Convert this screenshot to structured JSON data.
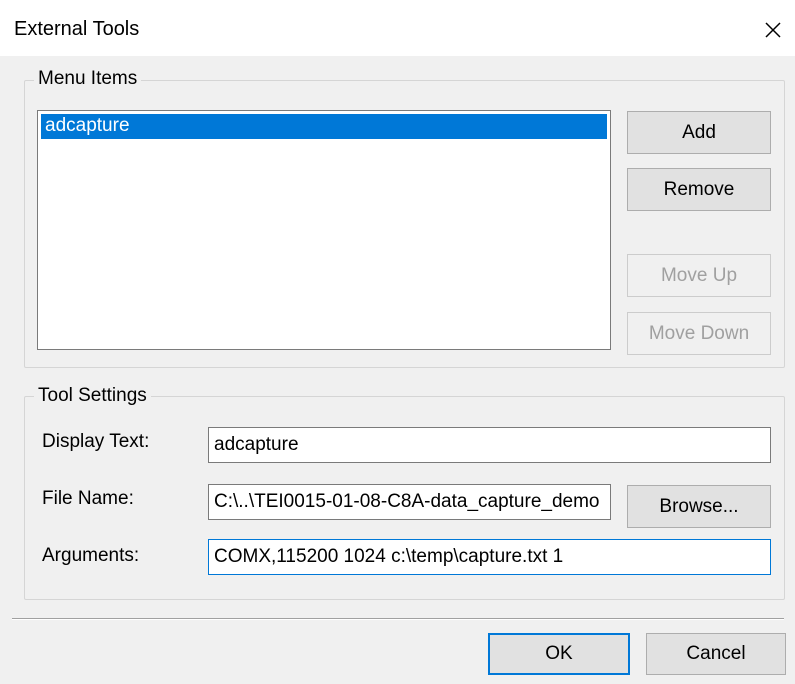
{
  "window": {
    "title": "External Tools"
  },
  "menu_items": {
    "group_label": "Menu Items",
    "items": [
      "adcapture"
    ],
    "selected_index": 0,
    "buttons": {
      "add": "Add",
      "remove": "Remove",
      "move_up": "Move Up",
      "move_down": "Move Down"
    }
  },
  "tool_settings": {
    "group_label": "Tool Settings",
    "display_text": {
      "label": "Display Text:",
      "value": "adcapture"
    },
    "file_name": {
      "label": "File Name:",
      "value": "C:\\..\\TEI0015-01-08-C8A-data_capture_demo"
    },
    "arguments": {
      "label": "Arguments:",
      "value": "COMX,115200 1024 c:\\temp\\capture.txt 1"
    },
    "browse_label": "Browse..."
  },
  "footer": {
    "ok_label": "OK",
    "cancel_label": "Cancel"
  },
  "colors": {
    "accent": "#0078d7",
    "disabled_text": "#a0a0a0"
  }
}
